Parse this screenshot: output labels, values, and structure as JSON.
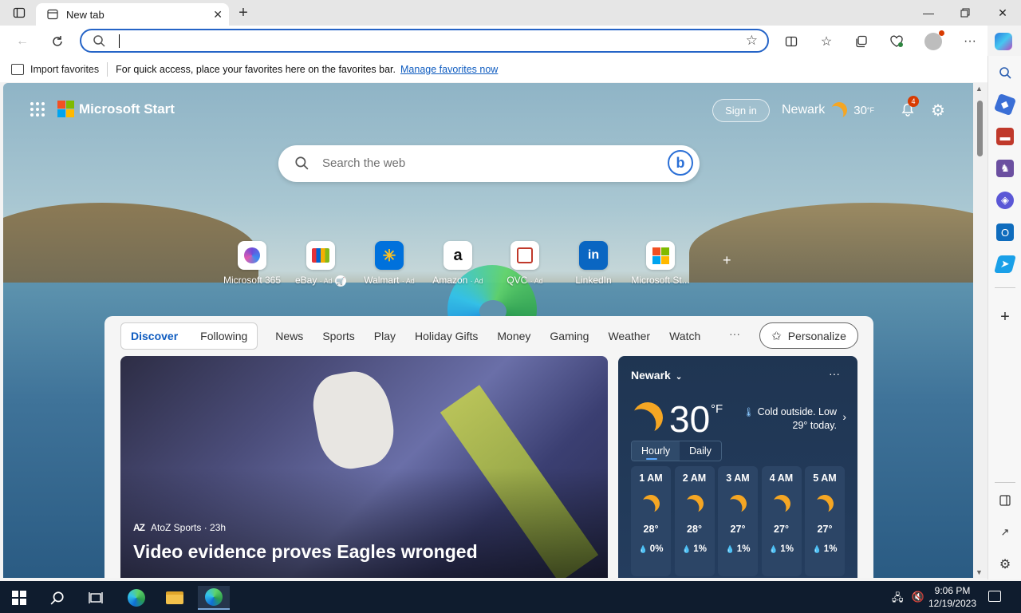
{
  "browser": {
    "tab_title": "New tab",
    "address_value": "",
    "favorites_bar": {
      "import_label": "Import favorites",
      "message": "For quick access, place your favorites here on the favorites bar.",
      "manage_link": "Manage favorites now"
    }
  },
  "page": {
    "brand": "Microsoft Start",
    "sign_in": "Sign in",
    "weather_city": "Newark",
    "weather_temp": "30",
    "weather_unit": "°F",
    "notifications_count": "4",
    "search_placeholder": "Search the web",
    "quick_links": [
      {
        "name": "Microsoft 365",
        "ad": ""
      },
      {
        "name": "eBay",
        "ad": "· Ad"
      },
      {
        "name": "Walmart",
        "ad": "· Ad"
      },
      {
        "name": "Amazon",
        "ad": "· Ad"
      },
      {
        "name": "QVC",
        "ad": "· Ad"
      },
      {
        "name": "LinkedIn",
        "ad": ""
      },
      {
        "name": "Microsoft St...",
        "ad": ""
      }
    ],
    "feed_tabs": {
      "primary": [
        "Discover",
        "Following"
      ],
      "categories": [
        "News",
        "Sports",
        "Play",
        "Holiday Gifts",
        "Money",
        "Gaming",
        "Weather",
        "Watch"
      ],
      "more": "···",
      "personalize": "Personalize"
    },
    "hero": {
      "source": "AtoZ Sports · 23h",
      "source_logo": "AZ",
      "headline": "Video evidence proves Eagles wronged"
    },
    "weather_card": {
      "city": "Newark",
      "temp": "30",
      "unit": "°F",
      "summary": "Cold outside. Low 29° today.",
      "toggle": [
        "Hourly",
        "Daily"
      ],
      "hours": [
        {
          "time": "1 AM",
          "temp": "28°",
          "precip": "0%"
        },
        {
          "time": "2 AM",
          "temp": "28°",
          "precip": "1%"
        },
        {
          "time": "3 AM",
          "temp": "27°",
          "precip": "1%"
        },
        {
          "time": "4 AM",
          "temp": "27°",
          "precip": "1%"
        },
        {
          "time": "5 AM",
          "temp": "27°",
          "precip": "1%"
        }
      ]
    }
  },
  "taskbar": {
    "time": "9:06 PM",
    "date": "12/19/2023"
  },
  "colors": {
    "accent": "#0f5cc0",
    "address_border": "#2564c7",
    "taskbar": "#0f1c2e",
    "weather_card": "#1f3552"
  }
}
